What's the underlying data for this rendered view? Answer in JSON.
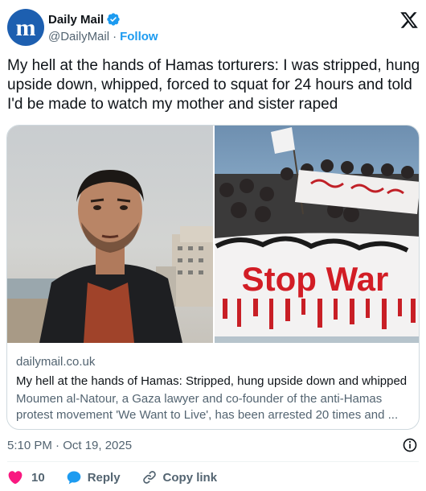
{
  "author": {
    "name": "Daily Mail",
    "handle": "@DailyMail",
    "follow_label": "Follow",
    "separator": "·",
    "avatar_icon": "daily-mail-logo",
    "avatar_color": "#1d5fb0",
    "verified_color": "#1d9bf0"
  },
  "tweet": {
    "text": "My hell at the hands of Hamas torturers: I was stripped, hung upside down, whipped, forced to squat for 24 hours and told I'd be made to watch my mother and sister raped"
  },
  "card": {
    "domain": "dailymail.co.uk",
    "title": "My hell at the hands of Hamas: Stripped, hung upside down and whipped",
    "description": "Moumen al-Natour, a Gaza lawyer and co-founder of the anti-Hamas protest movement 'We Want to Live', has been arrested 20 times and ...",
    "banner_text": "Stop War"
  },
  "meta": {
    "timestamp": "5:10 PM · Oct 19, 2025"
  },
  "actions": {
    "like_count": "10",
    "reply_label": "Reply",
    "copy_label": "Copy link",
    "like_color": "#f91880",
    "reply_color": "#1d9bf0"
  }
}
